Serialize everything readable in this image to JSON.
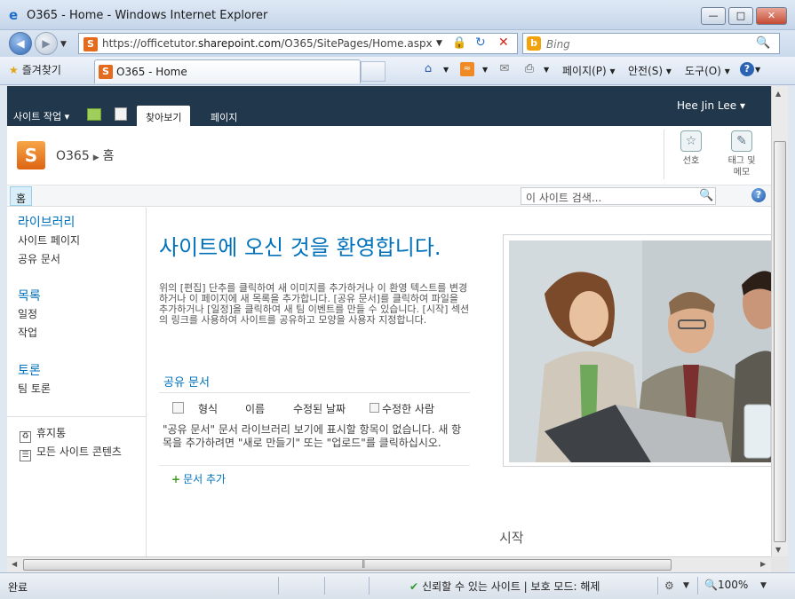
{
  "window": {
    "title": "O365 - Home - Windows Internet Explorer",
    "minimize": "—",
    "maximize": "□",
    "close": "✕"
  },
  "address": {
    "url_prefix": "https://officetutor.",
    "url_domain": "sharepoint.com",
    "url_path": "/O365/SitePages/Home.aspx",
    "search_placeholder": "Bing"
  },
  "favorites": {
    "label": "즐겨찾기",
    "tab_title": "O365 - Home"
  },
  "commandbar": {
    "page": "페이지(P)",
    "safety": "안전(S)",
    "tools": "도구(O)"
  },
  "ribbon": {
    "site_actions": "사이트 작업",
    "tabs": [
      "찾아보기",
      "페이지"
    ],
    "user": "Hee Jin Lee"
  },
  "titlearea": {
    "site": "O365",
    "page": "홈",
    "like": "선호",
    "tags_line1": "태그 및",
    "tags_line2": "메모"
  },
  "topnav": {
    "home": "홈",
    "search_placeholder": "이 사이트 검색..."
  },
  "leftnav": {
    "libraries": "라이브러리",
    "site_pages": "사이트 페이지",
    "shared_docs": "공유 문서",
    "lists": "목록",
    "calendar": "일정",
    "tasks": "작업",
    "discussions": "토론",
    "team_discussion": "팀 토론",
    "recycle_bin": "휴지통",
    "all_content": "모든 사이트 콘텐츠"
  },
  "main": {
    "welcome": "사이트에 오신 것을 환영합니다.",
    "intro": "위의 [편집] 단추를 클릭하여 새 이미지를 추가하거나 이 환영 텍스트를 변경하거나 이 페이지에 새 목록을 추가합니다. [공유 문서]를 클릭하여 파일을 추가하거나 [일정]을 클릭하여 새 팀 이벤트를 만들 수 있습니다. [시작] 섹션의 링크를 사용하여 사이트를 공유하고 모양을 사용자 지정합니다.",
    "docs_title": "공유 문서",
    "columns": [
      "형식",
      "이름",
      "수정된 날짜",
      "수정한 사람"
    ],
    "empty_message": "\"공유 문서\" 문서 라이브러리 보기에 표시할 항목이 없습니다. 새 항목을 추가하려면 \"새로 만들기\" 또는 \"업로드\"를 클릭하십시오.",
    "add_doc": "문서 추가",
    "get_started": "시작"
  },
  "status": {
    "done": "완료",
    "trust": "신뢰할 수 있는 사이트 | 보호 모드: 해제",
    "zoom": "100%"
  }
}
